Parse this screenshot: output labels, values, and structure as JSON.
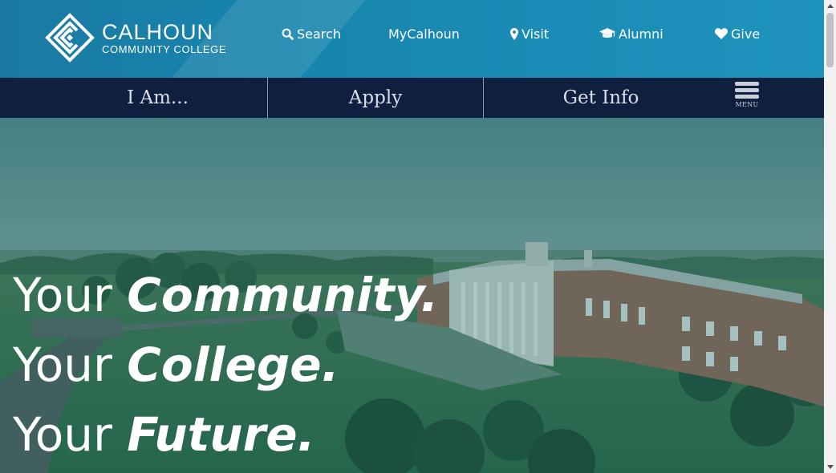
{
  "brand": {
    "name": "CALHOUN",
    "subtitle": "COMMUNITY COLLEGE",
    "logo_icon": "calhoun-c-logo-icon"
  },
  "utility_nav": [
    {
      "label": "Search",
      "icon": "search-icon"
    },
    {
      "label": "MyCalhoun",
      "icon": ""
    },
    {
      "label": "Visit",
      "icon": "map-marker-icon"
    },
    {
      "label": "Alumni",
      "icon": "graduation-cap-icon"
    },
    {
      "label": "Give",
      "icon": "heart-icon"
    }
  ],
  "sub_nav": {
    "items": [
      {
        "label": "I Am..."
      },
      {
        "label": "Apply"
      },
      {
        "label": "Get Info"
      }
    ],
    "menu_label": "MENU",
    "menu_icon": "hamburger-icon"
  },
  "hero": {
    "lines": [
      {
        "light": "Your ",
        "bold": "Community."
      },
      {
        "light": "Your ",
        "bold": "College."
      },
      {
        "light": "Your ",
        "bold": "Future."
      }
    ]
  },
  "colors": {
    "header_blue": "#1685ad",
    "subnav_navy": "#0e1f3f",
    "hero_teal_tint": "#0c5c5c",
    "text_white": "#ffffff"
  }
}
